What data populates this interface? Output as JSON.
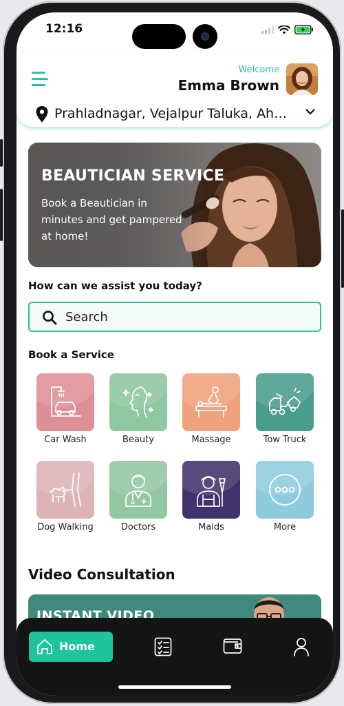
{
  "status_bar": {
    "time": "12:16"
  },
  "header": {
    "welcome": "Welcome",
    "user_name": "Emma Brown",
    "location": "Prahladnagar, Vejalpur Taluka, Ahmedabad"
  },
  "banner": {
    "title": "BEAUTICIAN SERVICE",
    "subtitle": "Book a Beautician in minutes and get pampered at home!"
  },
  "assist": {
    "heading": "How can we assist you today?",
    "search_placeholder": "Search"
  },
  "services": {
    "heading": "Book a Service",
    "items": [
      {
        "label": "Car Wash",
        "icon": "car-wash-icon",
        "color": "#de8f96"
      },
      {
        "label": "Beauty",
        "icon": "beauty-icon",
        "color": "#8ec7a0"
      },
      {
        "label": "Massage",
        "icon": "massage-icon",
        "color": "#efa27c"
      },
      {
        "label": "Tow Truck",
        "icon": "tow-truck-icon",
        "color": "#4a9d8d"
      },
      {
        "label": "Dog Walking",
        "icon": "dog-walking-icon",
        "color": "#ddb3b6"
      },
      {
        "label": "Doctors",
        "icon": "doctor-icon",
        "color": "#93c7a2"
      },
      {
        "label": "Maids",
        "icon": "maid-icon",
        "color": "#40336d"
      },
      {
        "label": "More",
        "icon": "more-icon",
        "color": "#8fcbdf"
      }
    ]
  },
  "video": {
    "heading": "Video Consultation",
    "card_title": "INSTANT VIDEO"
  },
  "bottom_nav": {
    "home_label": "Home",
    "items": [
      "home-icon",
      "bookings-list-icon",
      "wallet-icon",
      "profile-icon"
    ],
    "active_color": "#1fc39c"
  },
  "colors": {
    "accent": "#2bbf9f",
    "dark": "#141414"
  }
}
